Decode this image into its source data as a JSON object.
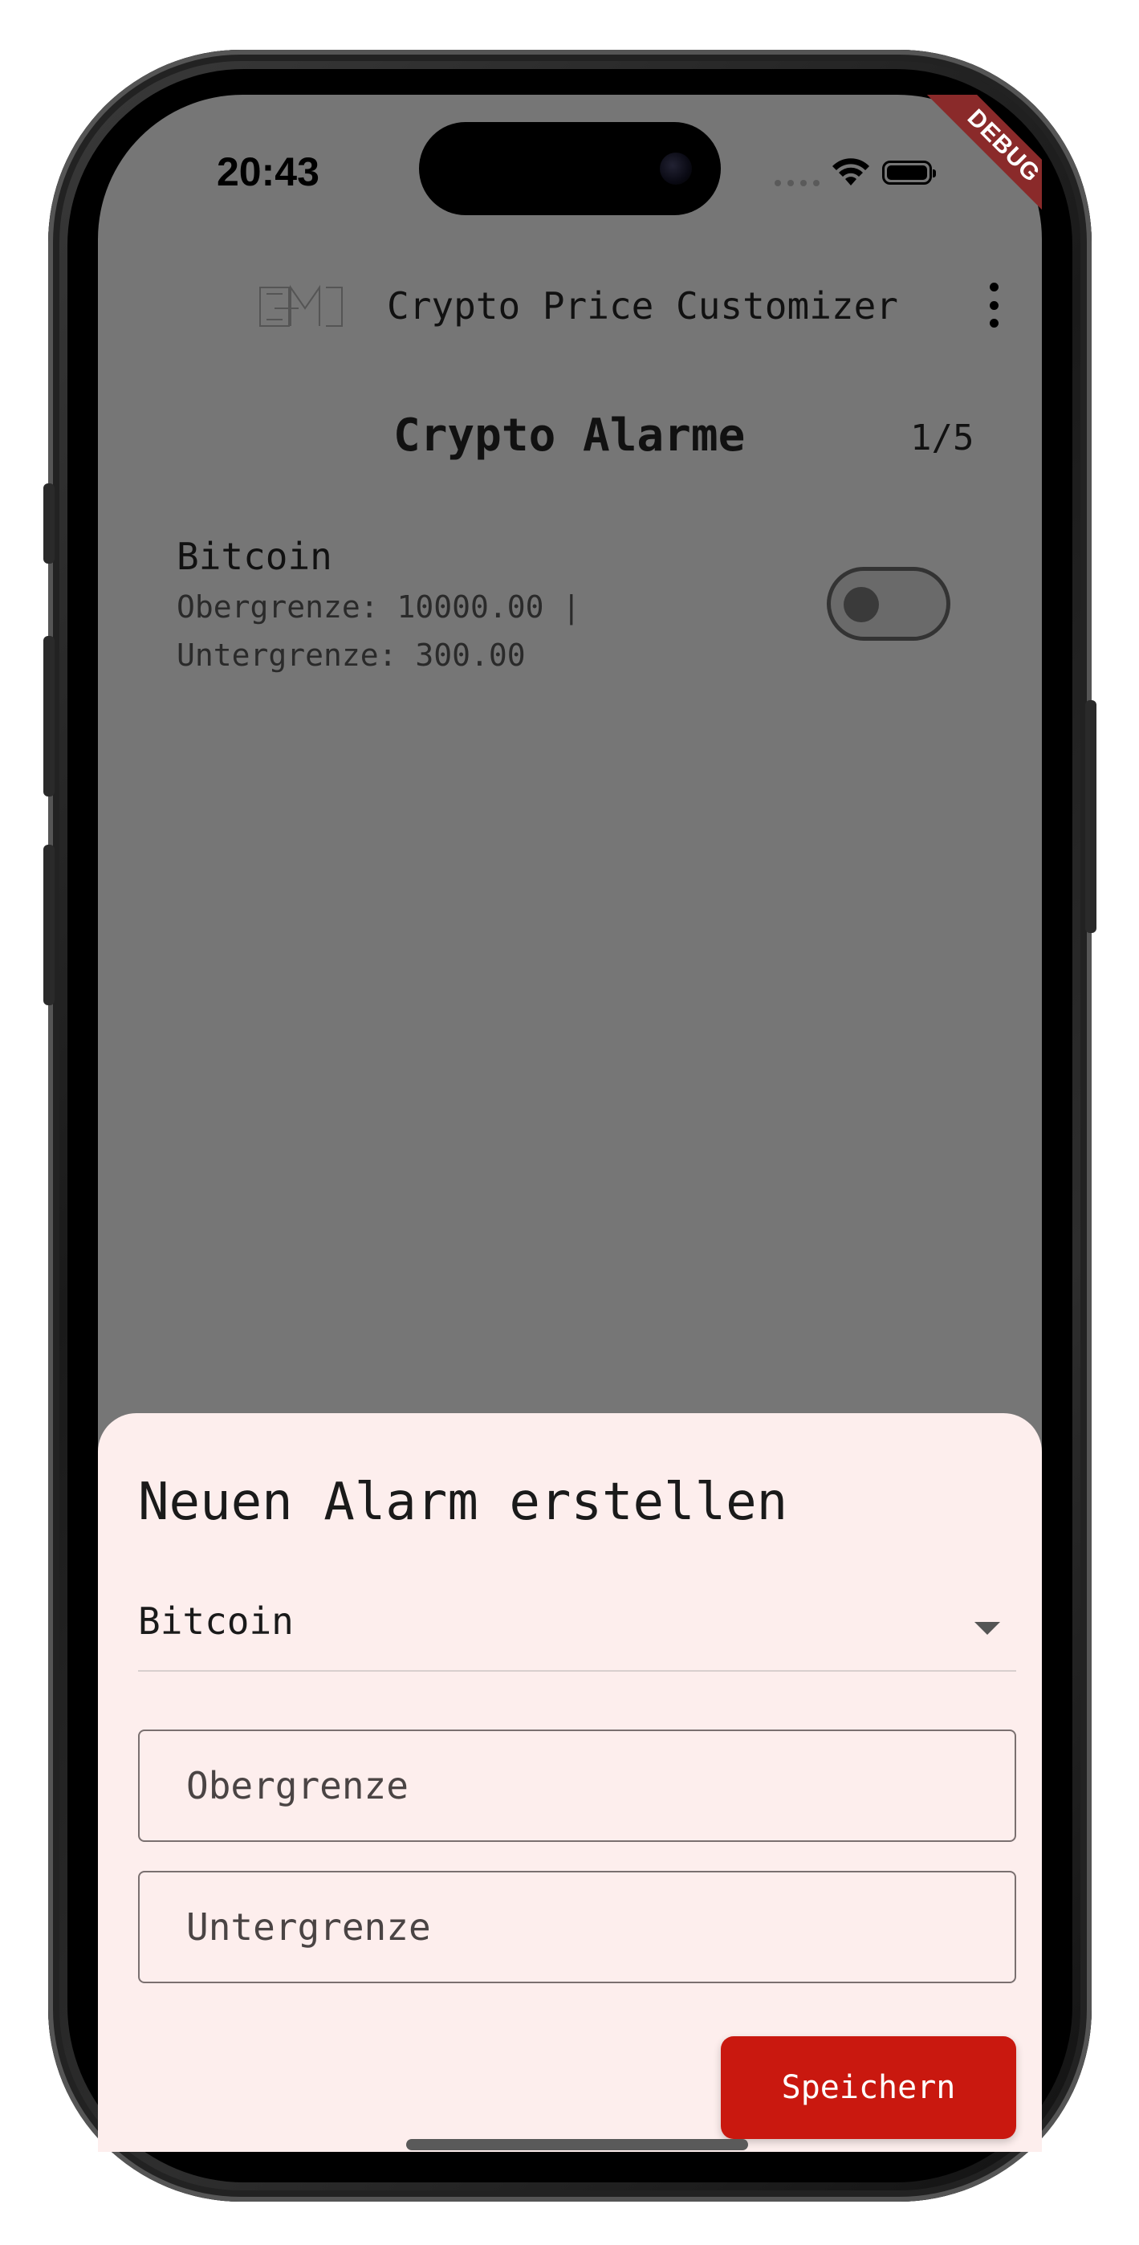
{
  "status_bar": {
    "time": "20:43",
    "debug_banner": "DEBUG"
  },
  "app_bar": {
    "title": "Crypto Price Customizer",
    "logo_icon": "cpm-logo-icon",
    "menu_icon": "more-vert-icon"
  },
  "alarms": {
    "title": "Crypto Alarme",
    "counter": "1/5",
    "items": [
      {
        "name": "Bitcoin",
        "detail": "Obergrenze: 10000.00 |\nUntergrenze: 300.00",
        "enabled": false
      }
    ]
  },
  "sheet": {
    "title": "Neuen Alarm erstellen",
    "dropdown_value": "Bitcoin",
    "upper_placeholder": "Obergrenze",
    "lower_placeholder": "Untergrenze",
    "save_label": "Speichern"
  },
  "colors": {
    "background_dim": "#767676",
    "sheet_bg": "#fdeeed",
    "accent": "#c9180f",
    "debug_banner": "#8a2a2a"
  }
}
